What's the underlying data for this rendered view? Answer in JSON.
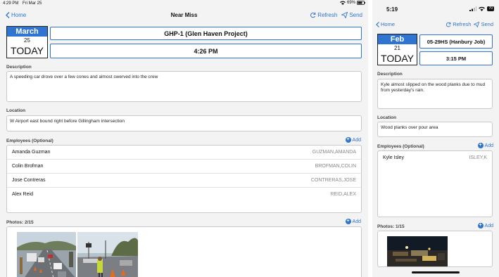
{
  "ipad": {
    "status": {
      "time": "4:29 PM",
      "date": "Fri Mar 25",
      "battery": "69%"
    },
    "nav": {
      "back_label": "Home",
      "title": "Near Miss",
      "refresh_label": "Refresh",
      "send_label": "Send"
    },
    "date_block": {
      "month": "March",
      "day": "25",
      "today": "TODAY"
    },
    "project": "GHP-1 (Glen Haven Project)",
    "time": "4:26 PM",
    "description": {
      "label": "Description",
      "text": "A speeding car drove over a few cones and almost swerved into the crew"
    },
    "location": {
      "label": "Location",
      "text": "W Airport east bound right before Gillingham intersection"
    },
    "employees": {
      "label": "Employees (Optional)",
      "add_label": "Add",
      "rows": [
        {
          "name": "Amanda Guzman",
          "code": "GUZMAN,AMANDA"
        },
        {
          "name": "Colin Brofman",
          "code": "BROFMAN,COLIN"
        },
        {
          "name": "Jose Contreras",
          "code": "CONTRERAS,JOSE"
        },
        {
          "name": "Alex Reid",
          "code": "REID,ALEX"
        }
      ]
    },
    "photos": {
      "label": "Photos: 2/15",
      "add_label": "Add"
    }
  },
  "iphone": {
    "status": {
      "time": "5:19",
      "battery": "70"
    },
    "nav": {
      "back_label": "Home",
      "refresh_label": "Refresh",
      "send_label": "Send"
    },
    "date_block": {
      "month": "Feb",
      "day": "21",
      "today": "TODAY"
    },
    "project": "05-29HS (Hanbury Job)",
    "time": "3:15 PM",
    "description": {
      "label": "Description",
      "text": "Kyle almost slipped on the wood planks due to mud from yesterday's rain."
    },
    "location": {
      "label": "Location",
      "text": "Wood planks over pour area"
    },
    "employees": {
      "label": "Employees (Optional)",
      "add_label": "Add",
      "rows": [
        {
          "name": "Kyle Isley",
          "code": "ISLEY,K"
        }
      ]
    },
    "photos": {
      "label": "Photos: 1/15",
      "add_label": "Add"
    }
  },
  "colors": {
    "accent": "#2f74d0",
    "background": "#f3f3f4",
    "border": "#c9c9cc"
  },
  "icons": [
    "chevron-left-icon",
    "refresh-icon",
    "send-icon",
    "add-circle-icon",
    "wifi-icon",
    "battery-icon",
    "signal-icon"
  ]
}
